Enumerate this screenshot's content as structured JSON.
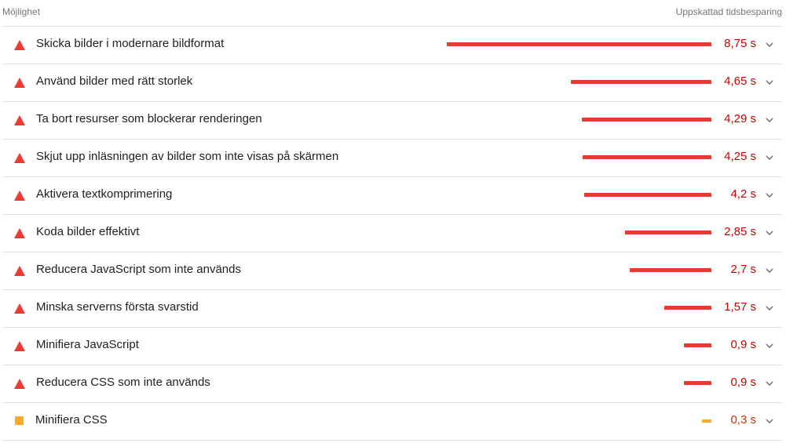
{
  "header": {
    "left_label": "Möjlighet",
    "right_label": "Uppskattad tidsbesparing"
  },
  "colors": {
    "fail": "#eb3a34",
    "average": "#ffa728",
    "fail_text": "#cc0000",
    "average_text": "#c33300"
  },
  "rows": [
    {
      "title": "Skicka bilder i modernare bildformat",
      "value_text": "8,75 s",
      "seconds": 8.75,
      "status": "fail",
      "icon": "warning-triangle-icon"
    },
    {
      "title": "Använd bilder med rätt storlek",
      "value_text": "4,65 s",
      "seconds": 4.65,
      "status": "fail",
      "icon": "warning-triangle-icon"
    },
    {
      "title": "Ta bort resurser som blockerar renderingen",
      "value_text": "4,29 s",
      "seconds": 4.29,
      "status": "fail",
      "icon": "warning-triangle-icon"
    },
    {
      "title": "Skjut upp inläsningen av bilder som inte visas på skärmen",
      "value_text": "4,25 s",
      "seconds": 4.25,
      "status": "fail",
      "icon": "warning-triangle-icon"
    },
    {
      "title": "Aktivera textkomprimering",
      "value_text": "4,2 s",
      "seconds": 4.2,
      "status": "fail",
      "icon": "warning-triangle-icon"
    },
    {
      "title": "Koda bilder effektivt",
      "value_text": "2,85 s",
      "seconds": 2.85,
      "status": "fail",
      "icon": "warning-triangle-icon"
    },
    {
      "title": "Reducera JavaScript som inte används",
      "value_text": "2,7 s",
      "seconds": 2.7,
      "status": "fail",
      "icon": "warning-triangle-icon"
    },
    {
      "title": "Minska serverns första svarstid",
      "value_text": "1,57 s",
      "seconds": 1.57,
      "status": "fail",
      "icon": "warning-triangle-icon"
    },
    {
      "title": "Minifiera JavaScript",
      "value_text": "0,9 s",
      "seconds": 0.9,
      "status": "fail",
      "icon": "warning-triangle-icon"
    },
    {
      "title": "Reducera CSS som inte används",
      "value_text": "0,9 s",
      "seconds": 0.9,
      "status": "fail",
      "icon": "warning-triangle-icon"
    },
    {
      "title": "Minifiera CSS",
      "value_text": "0,3 s",
      "seconds": 0.3,
      "status": "average",
      "icon": "warning-square-icon"
    }
  ]
}
